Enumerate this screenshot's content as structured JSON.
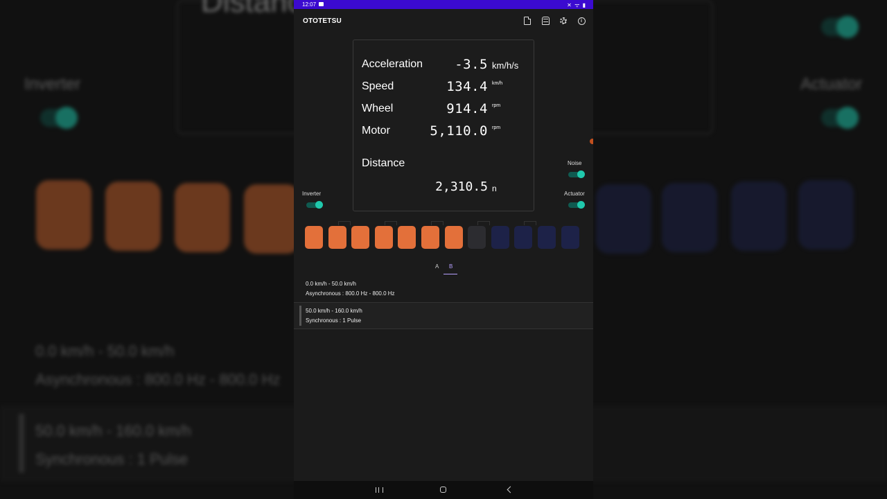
{
  "status_bar": {
    "time": "12:07",
    "icons": "✕ ᯤ ▮"
  },
  "app": {
    "title": "OTOTETSU"
  },
  "toolbar": [
    {
      "icon": "document-icon"
    },
    {
      "icon": "train-icon"
    },
    {
      "icon": "gear-icon"
    },
    {
      "icon": "info-icon"
    }
  ],
  "readout": {
    "acceleration": {
      "label": "Acceleration",
      "value": "-3.5",
      "unit": "km/h/s"
    },
    "speed": {
      "label": "Speed",
      "value": "134.4",
      "unit": "km/h"
    },
    "wheel": {
      "label": "Wheel",
      "value": "914.4",
      "unit": "rpm"
    },
    "motor": {
      "label": "Motor",
      "value": "5,110.0",
      "unit": "rpm"
    },
    "distance": {
      "label": "Distance",
      "value": "2,310.5",
      "unit": "n"
    }
  },
  "toggles": {
    "inverter": {
      "label": "Inverter",
      "on": true
    },
    "noise": {
      "label": "Noise",
      "on": true
    },
    "actuator": {
      "label": "Actuator",
      "on": true
    }
  },
  "train_cars": [
    "powered",
    "powered",
    "powered",
    "powered",
    "powered",
    "powered",
    "powered",
    "neutral",
    "regen",
    "regen",
    "regen",
    "regen"
  ],
  "tabs": {
    "a": "A",
    "b": "B",
    "active": "B"
  },
  "patterns": [
    {
      "range": "0.0 km/h - 50.0 km/h",
      "mode": "Asynchronous : 800.0 Hz - 800.0 Hz"
    },
    {
      "range": "50.0 km/h - 160.0 km/h",
      "mode": "Synchronous : 1 Pulse"
    }
  ],
  "colors": {
    "accent": "#3b0ad0",
    "toggle_on": "#20c9ad",
    "powered_car": "#e3703a",
    "regen_car": "#1d2248",
    "tab_active": "#b7a1ff"
  }
}
